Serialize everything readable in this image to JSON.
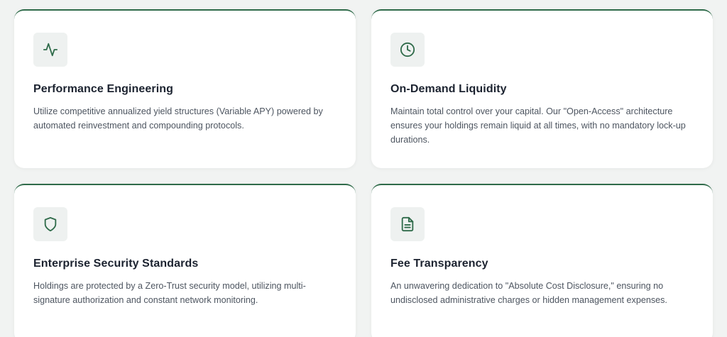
{
  "cards": [
    {
      "icon": "activity-icon",
      "title": "Performance Engineering",
      "description": "Utilize competitive annualized yield structures (Variable APY) powered by automated reinvestment and compounding protocols."
    },
    {
      "icon": "clock-icon",
      "title": "On-Demand Liquidity",
      "description": "Maintain total control over your capital. Our \"Open-Access\" architecture ensures your holdings remain liquid at all times, with no mandatory lock-up durations."
    },
    {
      "icon": "shield-icon",
      "title": "Enterprise Security Standards",
      "description": "Holdings are protected by a Zero-Trust security model, utilizing multi-signature authorization and constant network monitoring."
    },
    {
      "icon": "document-icon",
      "title": "Fee Transparency",
      "description": "An unwavering dedication to \"Absolute Cost Disclosure,\" ensuring no undisclosed administrative charges or hidden management expenses."
    }
  ],
  "colors": {
    "accent": "#2f6b4a",
    "card_background": "#ffffff",
    "icon_background": "#eef1f0",
    "title": "#1c2330",
    "body_text": "#4d5560",
    "page_background": "#f1f3f2"
  }
}
